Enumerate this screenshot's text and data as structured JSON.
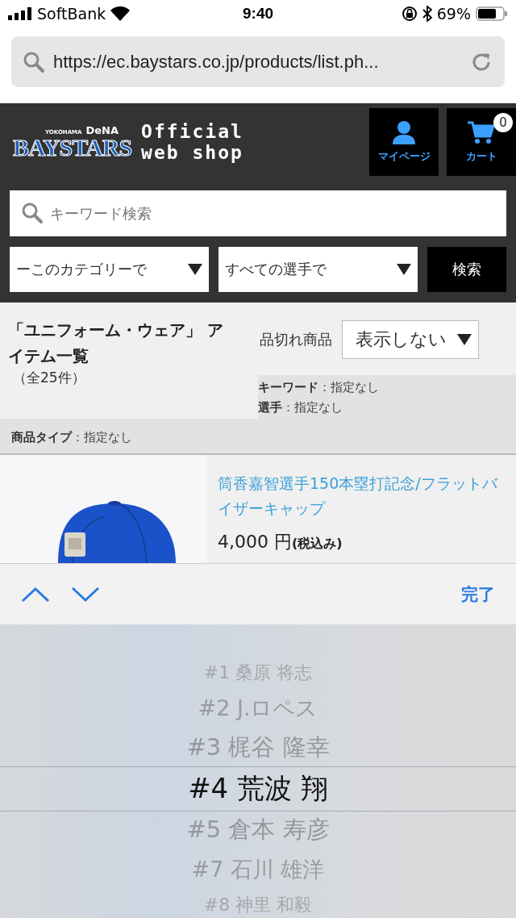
{
  "status_bar": {
    "carrier": "SoftBank",
    "time": "9:40",
    "battery": "69%"
  },
  "address_bar": {
    "url": "https://ec.baystars.co.jp/products/list.ph..."
  },
  "header": {
    "logo_small": "YOKOHAMA",
    "logo_dena": "DeNA",
    "logo_main": "BAYSTARS",
    "shop_line1": "Official",
    "shop_line2": "web shop",
    "mypage": "マイページ",
    "cart": "カート",
    "cart_count": "0"
  },
  "search": {
    "placeholder": "キーワード検索",
    "category": "ーこのカテゴリーで",
    "player": "すべての選手で",
    "button": "検索"
  },
  "listing": {
    "title": "「ユニフォーム・ウェア」 アイテム一覧",
    "count": "（全25件）",
    "soldout_label": "品切れ商品",
    "soldout_value": "表示しない",
    "filters": [
      {
        "key": "キーワード",
        "value": "：指定なし"
      },
      {
        "key": "選手",
        "value": "：指定なし"
      }
    ],
    "type_filter": {
      "key": "商品タイプ",
      "value": "：指定なし"
    }
  },
  "product": {
    "name": "筒香嘉智選手150本塁打記念/フラットバイザーキャップ",
    "price": "4,000 円",
    "tax": "(税込み)"
  },
  "toolbar": {
    "done": "完了"
  },
  "picker": [
    {
      "label": "#1 桑原 将志",
      "selected": false
    },
    {
      "label": "#2 J.ロペス",
      "selected": false
    },
    {
      "label": "#3 梶谷 隆幸",
      "selected": false
    },
    {
      "label": "#4 荒波 翔",
      "selected": true
    },
    {
      "label": "#5 倉本 寿彦",
      "selected": false
    },
    {
      "label": "#7 石川 雄洋",
      "selected": false
    },
    {
      "label": "#8 神里 和毅",
      "selected": false
    }
  ]
}
